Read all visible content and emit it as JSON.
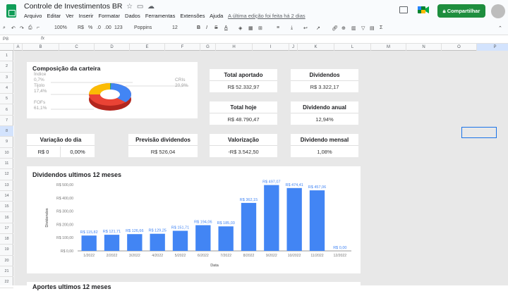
{
  "app": {
    "title": "Controle de Investimentos BR",
    "share_label": "Compartilhar",
    "last_edit": "A última edição foi feita há 2 dias"
  },
  "menu": [
    "Arquivo",
    "Editar",
    "Ver",
    "Inserir",
    "Formatar",
    "Dados",
    "Ferramentas",
    "Extensões",
    "Ajuda"
  ],
  "toolbar": {
    "zoom": "100%",
    "currency": "R$",
    "percent": "%",
    "decimals_less": ".0",
    "decimals_more": ".00",
    "format": "123",
    "font": "Poppins",
    "size": "12"
  },
  "formula": {
    "cell_ref": "P8",
    "fx": "fx"
  },
  "columns": [
    "A",
    "B",
    "C",
    "D",
    "E",
    "F",
    "G",
    "H",
    "I",
    "J",
    "K",
    "L",
    "M",
    "N",
    "O",
    "P"
  ],
  "rows": [
    "1",
    "2",
    "3",
    "4",
    "5",
    "6",
    "7",
    "8",
    "9",
    "10",
    "11",
    "12",
    "13",
    "14",
    "15",
    "16",
    "17",
    "18",
    "19",
    "20",
    "21",
    "22"
  ],
  "composition": {
    "title": "Composição da carteira",
    "legend": [
      {
        "name": "Índice",
        "pct": "0,7%"
      },
      {
        "name": "Tijolo",
        "pct": "17,4%"
      },
      {
        "name": "FOFs",
        "pct": "61,1%"
      },
      {
        "name": "CRIs",
        "pct": "20,9%"
      }
    ],
    "colors": {
      "Índice": "#34a853",
      "Tijolo": "#fbbc04",
      "FOFs": "#ea4335",
      "CRIs": "#4285f4"
    }
  },
  "kpis": {
    "total_aportado": {
      "title": "Total aportado",
      "value": "R$ 52.332,97"
    },
    "dividendos": {
      "title": "Dividendos",
      "value": "R$ 3.322,17"
    },
    "total_hoje": {
      "title": "Total hoje",
      "value": "R$ 48.790,47"
    },
    "dividendo_anual": {
      "title": "Dividendo anual",
      "value": "12,94%"
    },
    "variacao": {
      "title": "Variação do dia",
      "value_brl": "R$ 0",
      "value_pct": "0,00%"
    },
    "previsao": {
      "title": "Previsão dividendos",
      "value": "R$ 526,04"
    },
    "valorizacao": {
      "title": "Valorização",
      "value": "-R$ 3.542,50"
    },
    "dividendo_mensal": {
      "title": "Dividendo mensal",
      "value": "1,08%"
    }
  },
  "chart_data": [
    {
      "type": "bar",
      "title": "Dividendos ultimos 12 meses",
      "xlabel": "Data",
      "ylabel": "Dividendos",
      "categories": [
        "1/2022",
        "2/2022",
        "3/2022",
        "4/2022",
        "5/2022",
        "6/2022",
        "7/2022",
        "8/2022",
        "9/2022",
        "10/2022",
        "11/2022",
        "12/2022"
      ],
      "values": [
        115.82,
        121.71,
        126.66,
        129.25,
        151.71,
        194.06,
        185.03,
        362.15,
        497.07,
        474.41,
        457.06,
        0
      ],
      "value_labels": [
        "R$ 115,82",
        "R$ 121,71",
        "R$ 126,66",
        "R$ 129,25",
        "R$ 151,71",
        "R$ 194,06",
        "R$ 185,03",
        "R$ 362,15",
        "R$ 497,07",
        "R$ 474,41",
        "R$ 457,06",
        "R$ 0,00"
      ],
      "yticks": [
        "R$ 0,00",
        "R$ 100,00",
        "R$ 200,00",
        "R$ 300,00",
        "R$ 400,00",
        "R$ 500,00"
      ],
      "ylim": [
        0,
        500
      ],
      "color": "#4285f4"
    }
  ],
  "aportes": {
    "title": "Aportes ultimos 12 meses"
  }
}
